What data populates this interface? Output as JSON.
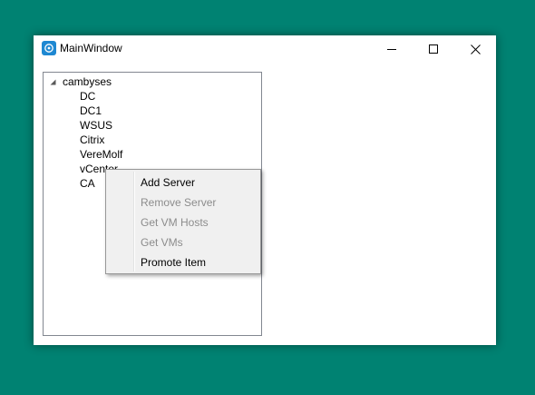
{
  "window": {
    "title": "MainWindow",
    "app_icon": "app-logo-icon",
    "controls": {
      "minimize_icon": "minimize-icon",
      "maximize_icon": "maximize-icon",
      "close_icon": "close-icon"
    }
  },
  "tree": {
    "root": {
      "label": "cambyses",
      "expanded": true,
      "expander_icon": "expanded-triangle-icon"
    },
    "children": [
      "DC",
      "DC1",
      "WSUS",
      "Citrix",
      "VereMolf",
      "vCenter",
      "CA"
    ]
  },
  "context_menu": {
    "items": [
      {
        "label": "Add Server",
        "enabled": true
      },
      {
        "label": "Remove Server",
        "enabled": false
      },
      {
        "label": "Get VM Hosts",
        "enabled": false
      },
      {
        "label": "Get VMs",
        "enabled": false
      },
      {
        "label": "Promote Item",
        "enabled": true
      }
    ]
  },
  "colors": {
    "desktop": "#008272",
    "window": "#ffffff",
    "menu_background": "#f0f0f0",
    "disabled_text": "#8c8c8c",
    "app_icon": "#1e88d2"
  }
}
